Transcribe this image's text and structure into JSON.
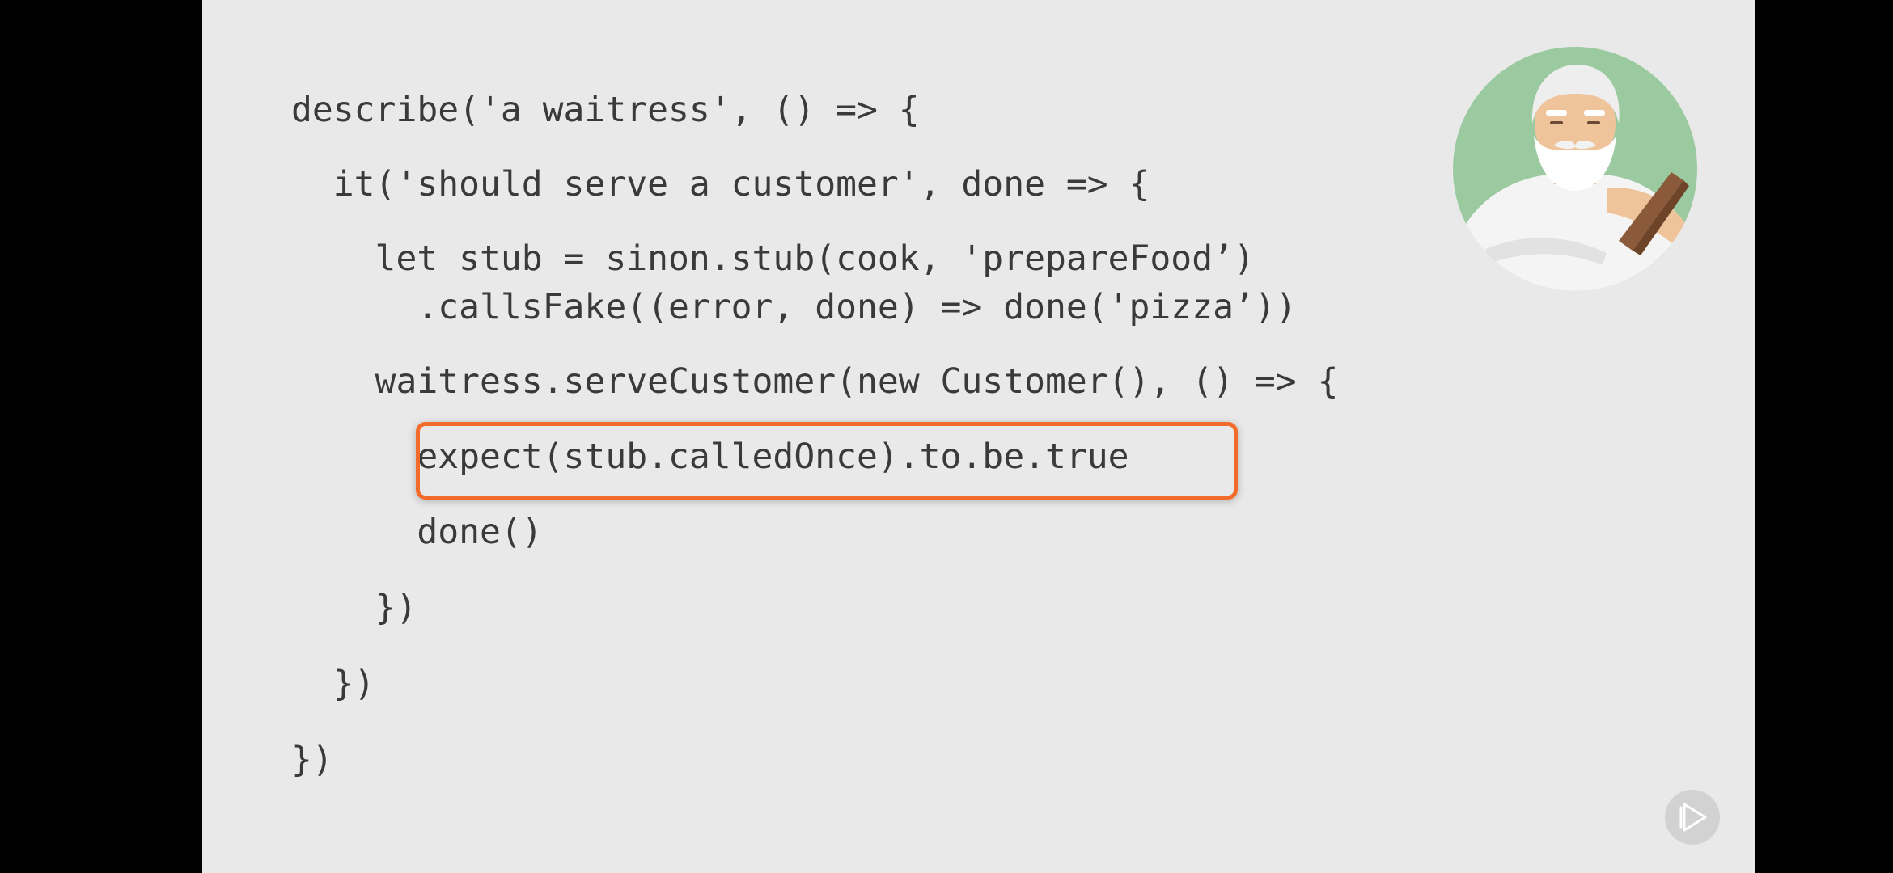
{
  "slide": {
    "code_lines": [
      "describe('a waitress', () => {",
      "  it('should serve a customer', done => {",
      "    let stub = sinon.stub(cook, 'prepareFood’)",
      "      .callsFake((error, done) => done('pizza’))",
      "    waitress.serveCustomer(new Customer(), () => {",
      "      expect(stub.calledOnce).to.be.true",
      "      done()",
      "    })",
      "  })",
      "})"
    ],
    "highlighted_line_index": 5
  },
  "colors": {
    "slide_background": "#e9e9e9",
    "code_text": "#3a3a3a",
    "highlight_border": "#f26b2a",
    "avatar_background": "#9ccaa0",
    "screen_letterbox": "#000000"
  },
  "icons": {
    "avatar": "bearded-old-man-avatar",
    "logo": "play-triangle-logo"
  }
}
